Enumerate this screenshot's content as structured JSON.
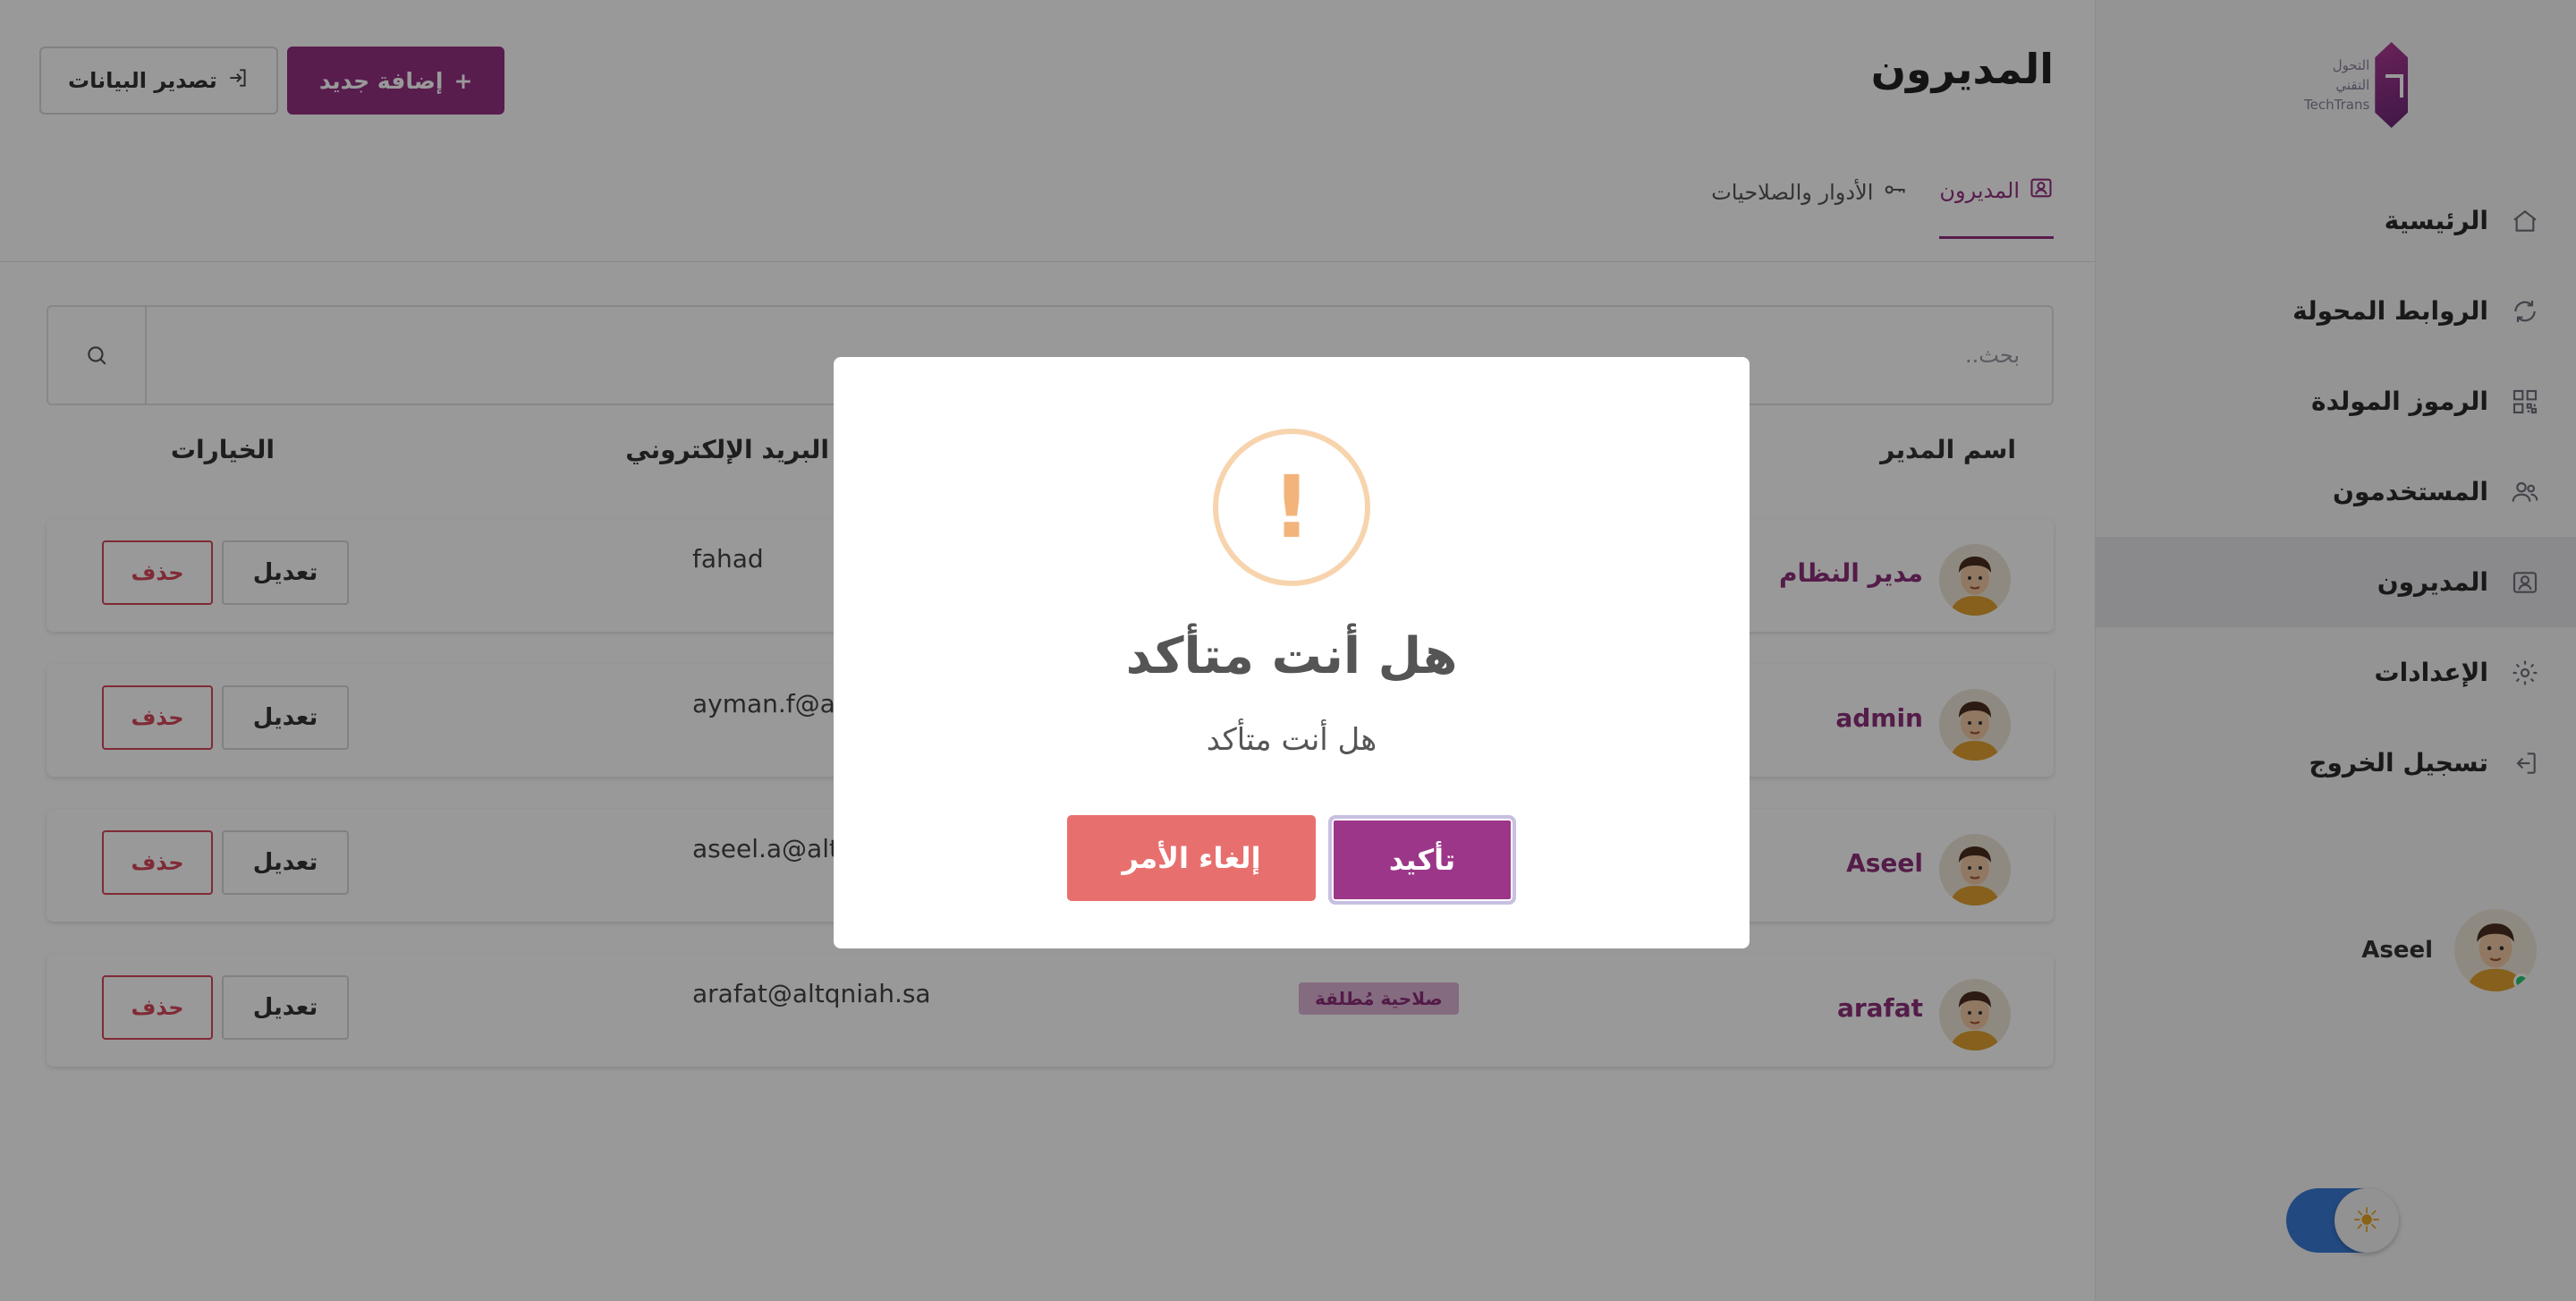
{
  "brand": {
    "logo_text_ar": "التحول التقني",
    "logo_text_en": "TechTrans"
  },
  "sidebar": {
    "items": [
      {
        "label": "الرئيسية",
        "icon": "home-icon",
        "active": false
      },
      {
        "label": "الروابط المحولة",
        "icon": "refresh-icon",
        "active": false
      },
      {
        "label": "الرموز المولدة",
        "icon": "qr-code-icon",
        "active": false
      },
      {
        "label": "المستخدمون",
        "icon": "users-icon",
        "active": false
      },
      {
        "label": "المديرون",
        "icon": "admin-id-icon",
        "active": true
      },
      {
        "label": "الإعدادات",
        "icon": "gear-icon",
        "active": false
      },
      {
        "label": "تسجيل الخروج",
        "icon": "logout-icon",
        "active": false
      }
    ],
    "user": {
      "name": "Aseel",
      "status": "online"
    }
  },
  "header": {
    "title": "المديرون",
    "add_button": "إضافة جديد",
    "add_icon": "+",
    "export_button": "تصدير البيانات"
  },
  "tabs": [
    {
      "label": "المديرون",
      "icon": "admin-id-icon",
      "active": true
    },
    {
      "label": "الأدوار والصلاحيات",
      "icon": "key-icon",
      "active": false
    }
  ],
  "search": {
    "placeholder": "بحث..",
    "value": ""
  },
  "table": {
    "headers": {
      "name": "اسم المدير",
      "email": "البريد الإلكتروني",
      "options": "الخيارات"
    },
    "rows": [
      {
        "name": "مدير النظام",
        "email": "fahad",
        "role": ""
      },
      {
        "name": "admin",
        "email": "ayman.f@altq",
        "role": ""
      },
      {
        "name": "Aseel",
        "email": "aseel.a@altq",
        "role": ""
      },
      {
        "name": "arafat",
        "email": "arafat@altqniah.sa",
        "role": "صلاحية مُطلقة"
      }
    ],
    "edit_label": "تعديل",
    "delete_label": "حذف"
  },
  "modal": {
    "icon": "!",
    "title": "هل أنت متأكد",
    "text": "هل أنت متأكد",
    "confirm_label": "تأكيد",
    "cancel_label": "إلغاء الأمر"
  },
  "colors": {
    "brand": "#932f80",
    "danger": "#d5475a",
    "cancel": "#e7706e",
    "warning": "#f2b47a",
    "toggle": "#3a7bd5"
  }
}
